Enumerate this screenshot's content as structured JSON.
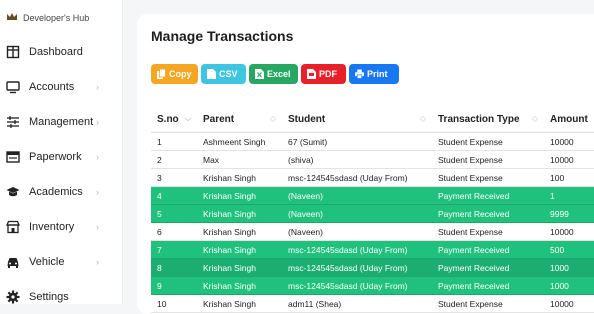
{
  "brand": {
    "name": "Developer's Hub",
    "icon": "crown-icon"
  },
  "sidebar": {
    "items": [
      {
        "label": "Dashboard",
        "icon": "dashboard-icon",
        "chevron": ""
      },
      {
        "label": "Accounts",
        "icon": "monitor-icon",
        "chevron": "›"
      },
      {
        "label": "Management",
        "icon": "sliders-icon",
        "chevron": "›"
      },
      {
        "label": "Paperwork",
        "icon": "paperwork-icon",
        "chevron": "›"
      },
      {
        "label": "Academics",
        "icon": "graduation-cap-icon",
        "chevron": "›"
      },
      {
        "label": "Inventory",
        "icon": "store-icon",
        "chevron": "›"
      },
      {
        "label": "Vehicle",
        "icon": "car-icon",
        "chevron": "›"
      },
      {
        "label": "Settings",
        "icon": "gear-icon",
        "chevron": ""
      }
    ]
  },
  "main": {
    "title": "Manage Transactions",
    "buttons": {
      "copy": "Copy",
      "csv": "CSV",
      "excel": "Excel",
      "pdf": "PDF",
      "print": "Print"
    },
    "columns": {
      "sno": "S.no",
      "parent": "Parent",
      "student": "Student",
      "type": "Transaction Type",
      "amount": "Amount"
    },
    "rows": [
      {
        "sno": "1",
        "parent": "Ashmeent Singh",
        "student": "67 (Sumit)",
        "type": "Student Expense",
        "amount": "10000"
      },
      {
        "sno": "2",
        "parent": "Max",
        "student": "(shiva)",
        "type": "Student Expense",
        "amount": "10000"
      },
      {
        "sno": "3",
        "parent": "Krishan Singh",
        "student": "msc-124545sdasd (Uday From)",
        "type": "Student Expense",
        "amount": "100"
      },
      {
        "sno": "4",
        "parent": "Krishan Singh",
        "student": "(Naveen)",
        "type": "Payment Received",
        "amount": "1"
      },
      {
        "sno": "5",
        "parent": "Krishan Singh",
        "student": "(Naveen)",
        "type": "Payment Received",
        "amount": "9999"
      },
      {
        "sno": "6",
        "parent": "Krishan Singh",
        "student": "(Naveen)",
        "type": "Student Expense",
        "amount": "10000"
      },
      {
        "sno": "7",
        "parent": "Krishan Singh",
        "student": "msc-124545sdasd (Uday From)",
        "type": "Payment Received",
        "amount": "500"
      },
      {
        "sno": "8",
        "parent": "Krishan Singh",
        "student": "msc-124545sdasd (Uday From)",
        "type": "Payment Received",
        "amount": "1000"
      },
      {
        "sno": "9",
        "parent": "Krishan Singh",
        "student": "msc-124545sdasd (Uday From)",
        "type": "Payment Received",
        "amount": "1000"
      },
      {
        "sno": "10",
        "parent": "Krishan Singh",
        "student": "adm11 (Shea)",
        "type": "Student Expense",
        "amount": "10000"
      }
    ]
  },
  "colors": {
    "payment_received_row": "#20c07d",
    "copy": "#f5a623",
    "csv": "#3ec6e0",
    "excel": "#28a763",
    "pdf": "#e7202a",
    "print": "#1877f2"
  }
}
